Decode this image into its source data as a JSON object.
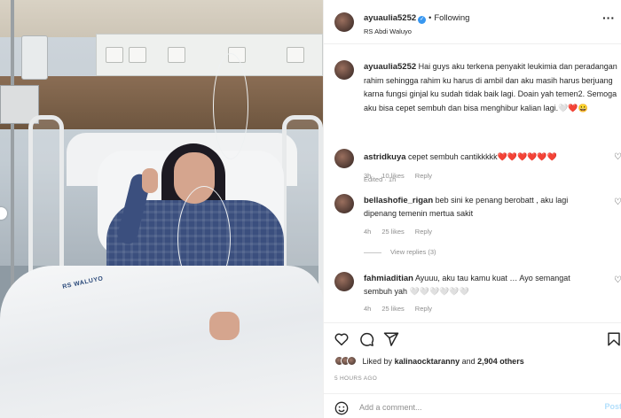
{
  "post": {
    "username": "ayuaulia5252",
    "separator": "•",
    "follow_status": "Following",
    "location": "RS Abdi Waluyo",
    "blanket_text": "RS WALUYO"
  },
  "caption": {
    "username": "ayuaulia5252",
    "text": "Hai guys aku terkena penyakit leukimia dan peradangan rahim sehingga rahim ku harus di ambil dan aku masih harus berjuang karna fungsi ginjal ku sudah tidak baik lagi. Doain yah temen2. Semoga aku bisa cepet sembuh dan bisa menghibur kalian lagi.🤍❤️😀",
    "meta": "Edited · 1h"
  },
  "comments": [
    {
      "username": "astridkuya",
      "text": "cepet sembuh cantikkkkk❤️❤️❤️❤️❤️❤️",
      "time": "3h",
      "likes": "10 likes",
      "reply": "Reply"
    },
    {
      "username": "bellashofie_rigan",
      "text": "beb sini ke penang berobatt , aku lagi dipenang temenin mertua sakit",
      "time": "4h",
      "likes": "25 likes",
      "reply": "Reply",
      "view_replies": "View replies (3)"
    },
    {
      "username": "fahmiaditian",
      "text": "Ayuuu, aku tau kamu kuat … Ayo semangat sembuh yah 🤍🤍🤍🤍🤍🤍",
      "time": "4h",
      "likes": "25 likes",
      "reply": "Reply"
    }
  ],
  "engagement": {
    "liked_by_prefix": "Liked by",
    "liked_by_user": "kalinaocktaranny",
    "and_text": "and",
    "others_count": "2,904 others",
    "time_ago": "5 HOURS AGO"
  },
  "add_comment": {
    "placeholder": "Add a comment...",
    "post_label": "Post"
  },
  "colors": {
    "verified": "#3897f0",
    "text": "#262626",
    "muted": "#8e8e8e",
    "post_disabled": "#b2dffc",
    "gown": "#3b4f7e"
  },
  "icons": [
    "verified-badge-icon",
    "more-options-icon",
    "heart-icon",
    "comment-icon",
    "share-icon",
    "bookmark-icon",
    "emoji-icon"
  ]
}
